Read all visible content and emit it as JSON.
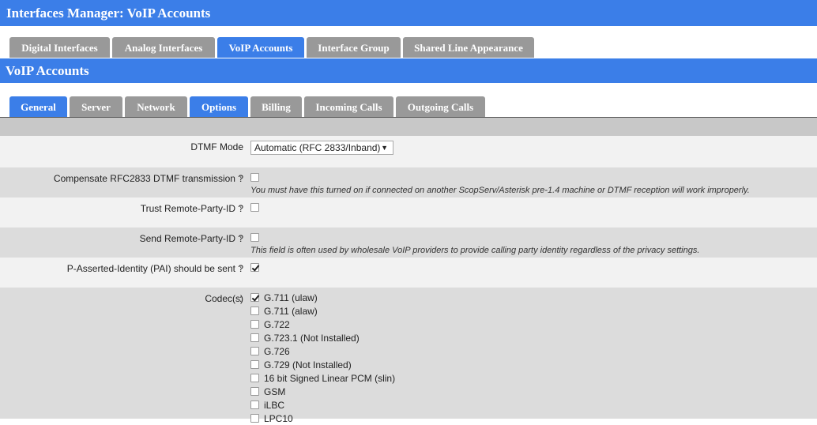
{
  "window": {
    "title": "Interfaces Manager:  VoIP Accounts"
  },
  "top_tabs": [
    {
      "label": "Digital Interfaces",
      "active": false
    },
    {
      "label": "Analog Interfaces",
      "active": false
    },
    {
      "label": "VoIP Accounts",
      "active": true
    },
    {
      "label": "Interface Group",
      "active": false
    },
    {
      "label": "Shared Line Appearance",
      "active": false
    }
  ],
  "section": {
    "title": "VoIP Accounts"
  },
  "sub_tabs": [
    {
      "label": "General",
      "active": true
    },
    {
      "label": "Server",
      "active": false
    },
    {
      "label": "Network",
      "active": false
    },
    {
      "label": "Options",
      "active": true
    },
    {
      "label": "Billing",
      "active": false
    },
    {
      "label": "Incoming Calls",
      "active": false
    },
    {
      "label": "Outgoing Calls",
      "active": false
    }
  ],
  "form": {
    "colon": ":",
    "dtmf": {
      "label": "DTMF Mode",
      "value": "Automatic (RFC 2833/Inband)",
      "arrow": "▼"
    },
    "compensate": {
      "label": "Compensate RFC2833 DTMF transmission ?",
      "checked": false,
      "hint": "You must have this turned on if connected on another ScopServ/Asterisk pre-1.4 machine or DTMF reception will work improperly."
    },
    "trust": {
      "label": "Trust Remote-Party-ID ?",
      "checked": false
    },
    "send": {
      "label": "Send Remote-Party-ID ?",
      "checked": false,
      "hint": "This field is often used by wholesale VoIP providers to provide calling party identity regardless of the privacy settings."
    },
    "pai": {
      "label": "P-Asserted-Identity (PAI) should be sent ?",
      "checked": true
    },
    "codecs": {
      "label": "Codec(s)",
      "items": [
        {
          "label": "G.711 (ulaw)",
          "checked": true
        },
        {
          "label": "G.711 (alaw)",
          "checked": false
        },
        {
          "label": "G.722",
          "checked": false
        },
        {
          "label": "G.723.1 (Not Installed)",
          "checked": false
        },
        {
          "label": "G.726",
          "checked": false
        },
        {
          "label": "G.729 (Not Installed)",
          "checked": false
        },
        {
          "label": "16 bit Signed Linear PCM (slin)",
          "checked": false
        },
        {
          "label": "GSM",
          "checked": false
        },
        {
          "label": "iLBC",
          "checked": false
        },
        {
          "label": "LPC10",
          "checked": false
        }
      ]
    }
  },
  "colors": {
    "accent": "#3b7ee8",
    "tab_inactive": "#999999"
  }
}
